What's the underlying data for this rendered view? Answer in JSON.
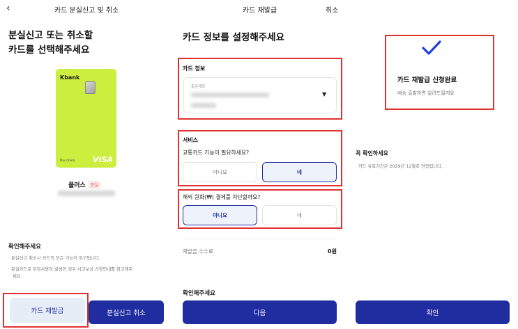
{
  "screen1": {
    "header_title": "카드 분실신고 및 취소",
    "back_icon": "chevron-left-icon",
    "title_line1": "분실신고 또는 취소할",
    "title_line2": "카드를 선택해주세요",
    "card": {
      "brand": "Kbank",
      "network": "VISA",
      "type_text": "Plus Check",
      "color": "#cbee3f"
    },
    "card_name": "플러스",
    "card_badge": "분실",
    "notice_title": "확인해주세요",
    "notices": [
      "분실신고 취소시 카드의 모든 기능이 복구됩니다.",
      "분실카드로 부정사용이 발생한 경우 사고보상 신청안내를 참고해주",
      "세요."
    ],
    "reissue_button": "카드 재발급",
    "cancel_button": "분실신고 취소"
  },
  "screen2": {
    "header_title": "카드 재발급",
    "header_cancel": "취소",
    "title": "카드 정보를 설정해주세요",
    "card_info_label": "카드 정보",
    "account_label": "출금계좌",
    "dropdown_icon": "caret-down-icon",
    "service_label": "서비스",
    "transit_question": "교통카드 기능이 필요하세요?",
    "transit_options": [
      "아니요",
      "네"
    ],
    "transit_selected": "네",
    "overseas_question": "해외 원화(₩) 결제를 차단할까요?",
    "overseas_options": [
      "아니요",
      "네"
    ],
    "overseas_selected": "아니요",
    "fee_label": "재발급 수수료",
    "fee_value": "0원",
    "notice_title": "확인해주세요",
    "next_button": "다음"
  },
  "screen3": {
    "check_icon": "checkmark-icon",
    "done_title": "카드 재발급 신청완료",
    "done_sub": "배송 출발하면 알려드릴게요",
    "notice_title": "꼭 확인하세요",
    "notice": "카드 유효기간은 2029년 12월로 연장됩니다.",
    "confirm_button": "확인"
  },
  "colors": {
    "primary": "#1f2da0",
    "highlight": "#e03030",
    "card_lime": "#cbee3f"
  }
}
